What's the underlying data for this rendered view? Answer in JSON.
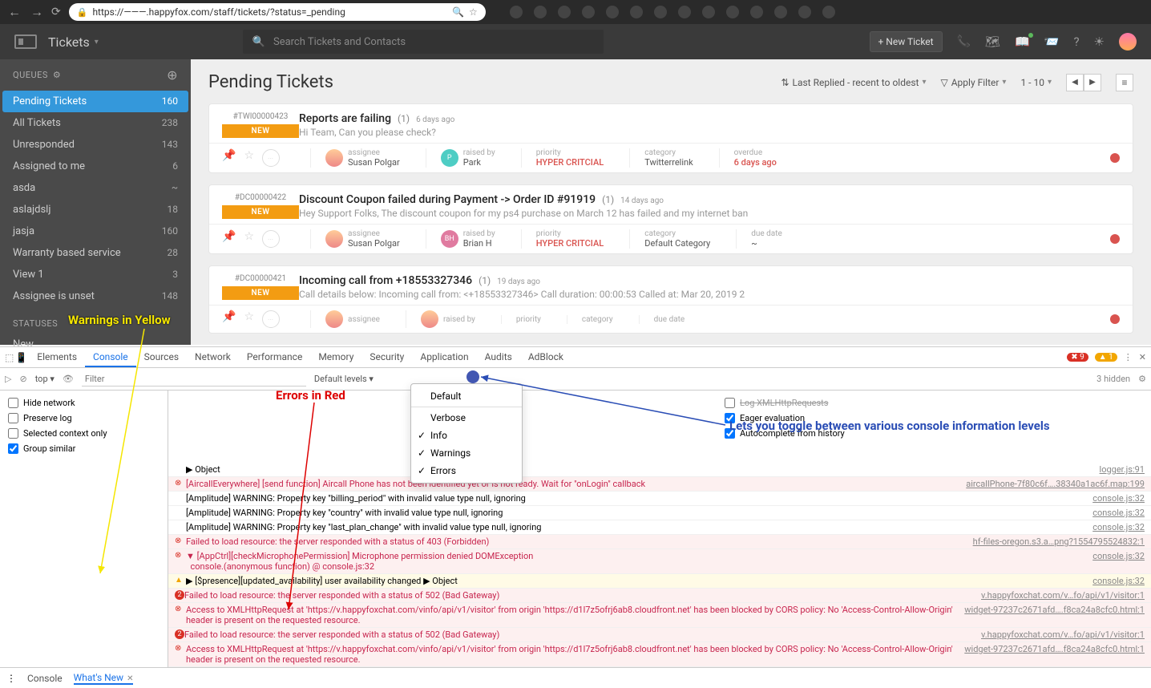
{
  "browser": {
    "url": "https://———.happyfox.com/staff/tickets/?status=_pending"
  },
  "app": {
    "title": "Tickets",
    "search_placeholder": "Search Tickets and Contacts",
    "new_ticket": "+ New Ticket"
  },
  "sidebar": {
    "queues_label": "QUEUES",
    "items": [
      {
        "label": "Pending Tickets",
        "count": "160"
      },
      {
        "label": "All Tickets",
        "count": "238"
      },
      {
        "label": "Unresponded",
        "count": "143"
      },
      {
        "label": "Assigned to me",
        "count": "6"
      },
      {
        "label": "asda",
        "count": "~"
      },
      {
        "label": "aslajdslj",
        "count": "18"
      },
      {
        "label": "jasja",
        "count": "160"
      },
      {
        "label": "Warranty based service",
        "count": "28"
      },
      {
        "label": "View 1",
        "count": "3"
      },
      {
        "label": "Assignee is unset",
        "count": "148"
      }
    ],
    "statuses_label": "STATUSES",
    "status_new": "New"
  },
  "content": {
    "title": "Pending Tickets",
    "sort": "Last Replied - recent to oldest",
    "filter": "Apply Filter",
    "range": "1 - 10"
  },
  "tickets": [
    {
      "id": "#TWI00000423",
      "badge": "NEW",
      "title": "Reports are failing",
      "count": "(1)",
      "age": "6 days ago",
      "preview": "Hi Team, Can you please check?",
      "assignee": "Susan Polgar",
      "raised_by": "Park",
      "raised_initial": "P",
      "priority": "HYPER CRITCIAL",
      "category": "Twitterrelink",
      "overdue_label": "overdue",
      "overdue": "6 days ago"
    },
    {
      "id": "#DC00000422",
      "badge": "NEW",
      "title": "Discount Coupon failed during Payment -> Order ID #91919",
      "count": "(1)",
      "age": "14 days ago",
      "preview": "Hey Support Folks, The discount coupon for my ps4 purchase on March 12 has failed and my internet ban",
      "assignee": "Susan Polgar",
      "raised_by": "Brian H",
      "raised_initial": "BH",
      "priority": "HYPER CRITCIAL",
      "category": "Default Category",
      "overdue_label": "due date",
      "overdue": "~"
    },
    {
      "id": "#DC00000421",
      "badge": "NEW",
      "title": "Incoming call from +18553327346",
      "count": "(1)",
      "age": "19 days ago",
      "preview": "Call details below: Incoming call from: <+18553327346> Call duration: 00:00:53 Called at: Mar 20, 2019 2",
      "assignee": "",
      "raised_by": "",
      "raised_initial": "",
      "priority": "",
      "category": "",
      "overdue_label": "due date",
      "overdue": ""
    }
  ],
  "labels": {
    "assignee": "assignee",
    "raised_by": "raised by",
    "priority": "priority",
    "category": "category"
  },
  "devtools": {
    "tabs": [
      "Elements",
      "Console",
      "Sources",
      "Network",
      "Performance",
      "Memory",
      "Security",
      "Application",
      "Audits",
      "AdBlock"
    ],
    "active_tab": "Console",
    "err_count": "9",
    "warn_count": "1",
    "top": "top",
    "filter_ph": "Filter",
    "levels": "Default levels",
    "hidden": "3 hidden",
    "side_checks": [
      {
        "label": "Hide network",
        "checked": false
      },
      {
        "label": "Preserve log",
        "checked": false
      },
      {
        "label": "Selected context only",
        "checked": false
      },
      {
        "label": "Group similar",
        "checked": true
      }
    ],
    "right_checks": [
      {
        "label": "Log XMLHttpRequests",
        "checked": false
      },
      {
        "label": "Eager evaluation",
        "checked": true
      },
      {
        "label": "Autocomplete from history",
        "checked": true
      }
    ],
    "levels_items": [
      "Default",
      "Verbose",
      "Info",
      "Warnings",
      "Errors"
    ],
    "console": [
      {
        "type": "obj",
        "text": "▶ Object",
        "src": "logger.js:91"
      },
      {
        "type": "err",
        "text": "[AircallEverywhere] [send function] Aircall Phone has not been identified yet or is not ready. Wait for \"onLogin\" callback",
        "src": "aircallPhone-7f80c6f….38340a1ac6f.map:199"
      },
      {
        "type": "log",
        "text": "[Amplitude] WARNING: Property key \"billing_period\" with invalid value type null, ignoring",
        "src": "console.js:32"
      },
      {
        "type": "log",
        "text": "[Amplitude] WARNING: Property key \"country\" with invalid value type null, ignoring",
        "src": "console.js:32"
      },
      {
        "type": "log",
        "text": "[Amplitude] WARNING: Property key \"last_plan_change\" with invalid value type null, ignoring",
        "src": "console.js:32"
      },
      {
        "type": "err",
        "text": "Failed to load resource: the server responded with a status of 403 (Forbidden)",
        "src": "hf-files-oregon.s3.a…png?1554795524832:1"
      },
      {
        "type": "err",
        "text": "▼ [AppCtrl][checkMicrophonePermission] Microphone permission denied DOMException\n  console.(anonymous function) @ console.js:32",
        "src": "console.js:32"
      },
      {
        "type": "warn",
        "text": "▶ [$presence][updated_availability] user availability changed ▶ Object",
        "src": "console.js:32"
      },
      {
        "type": "err2",
        "badge": "2",
        "text": "Failed to load resource: the server responded with a status of 502 (Bad Gateway)",
        "src": "v.happyfoxchat.com/v…fo/api/v1/visitor:1"
      },
      {
        "type": "err",
        "text": "Access to XMLHttpRequest at 'https://v.happyfoxchat.com/vinfo/api/v1/visitor' from origin 'https://d1l7z5ofrj6ab8.cloudfront.net' has been blocked by CORS policy: No 'Access-Control-Allow-Origin' header is present on the requested resource.",
        "src": "widget-97237c2671afd….f8ca24a8cfc0.html:1"
      },
      {
        "type": "err2",
        "badge": "2",
        "text": "Failed to load resource: the server responded with a status of 502 (Bad Gateway)",
        "src": "v.happyfoxchat.com/v…fo/api/v1/visitor:1"
      },
      {
        "type": "err",
        "text": "Access to XMLHttpRequest at 'https://v.happyfoxchat.com/vinfo/api/v1/visitor' from origin 'https://d1l7z5ofrj6ab8.cloudfront.net' has been blocked by CORS policy: No 'Access-Control-Allow-Origin' header is present on the requested resource.",
        "src": "widget-97237c2671afd….f8ca24a8cfc0.html:1"
      }
    ],
    "bottom_tabs": {
      "console": "Console",
      "whatsnew": "What's New"
    }
  },
  "annotations": {
    "yellow": "Warnings in Yellow",
    "red": "Errors in Red",
    "blue": "Lets you toggle between various console information levels"
  }
}
